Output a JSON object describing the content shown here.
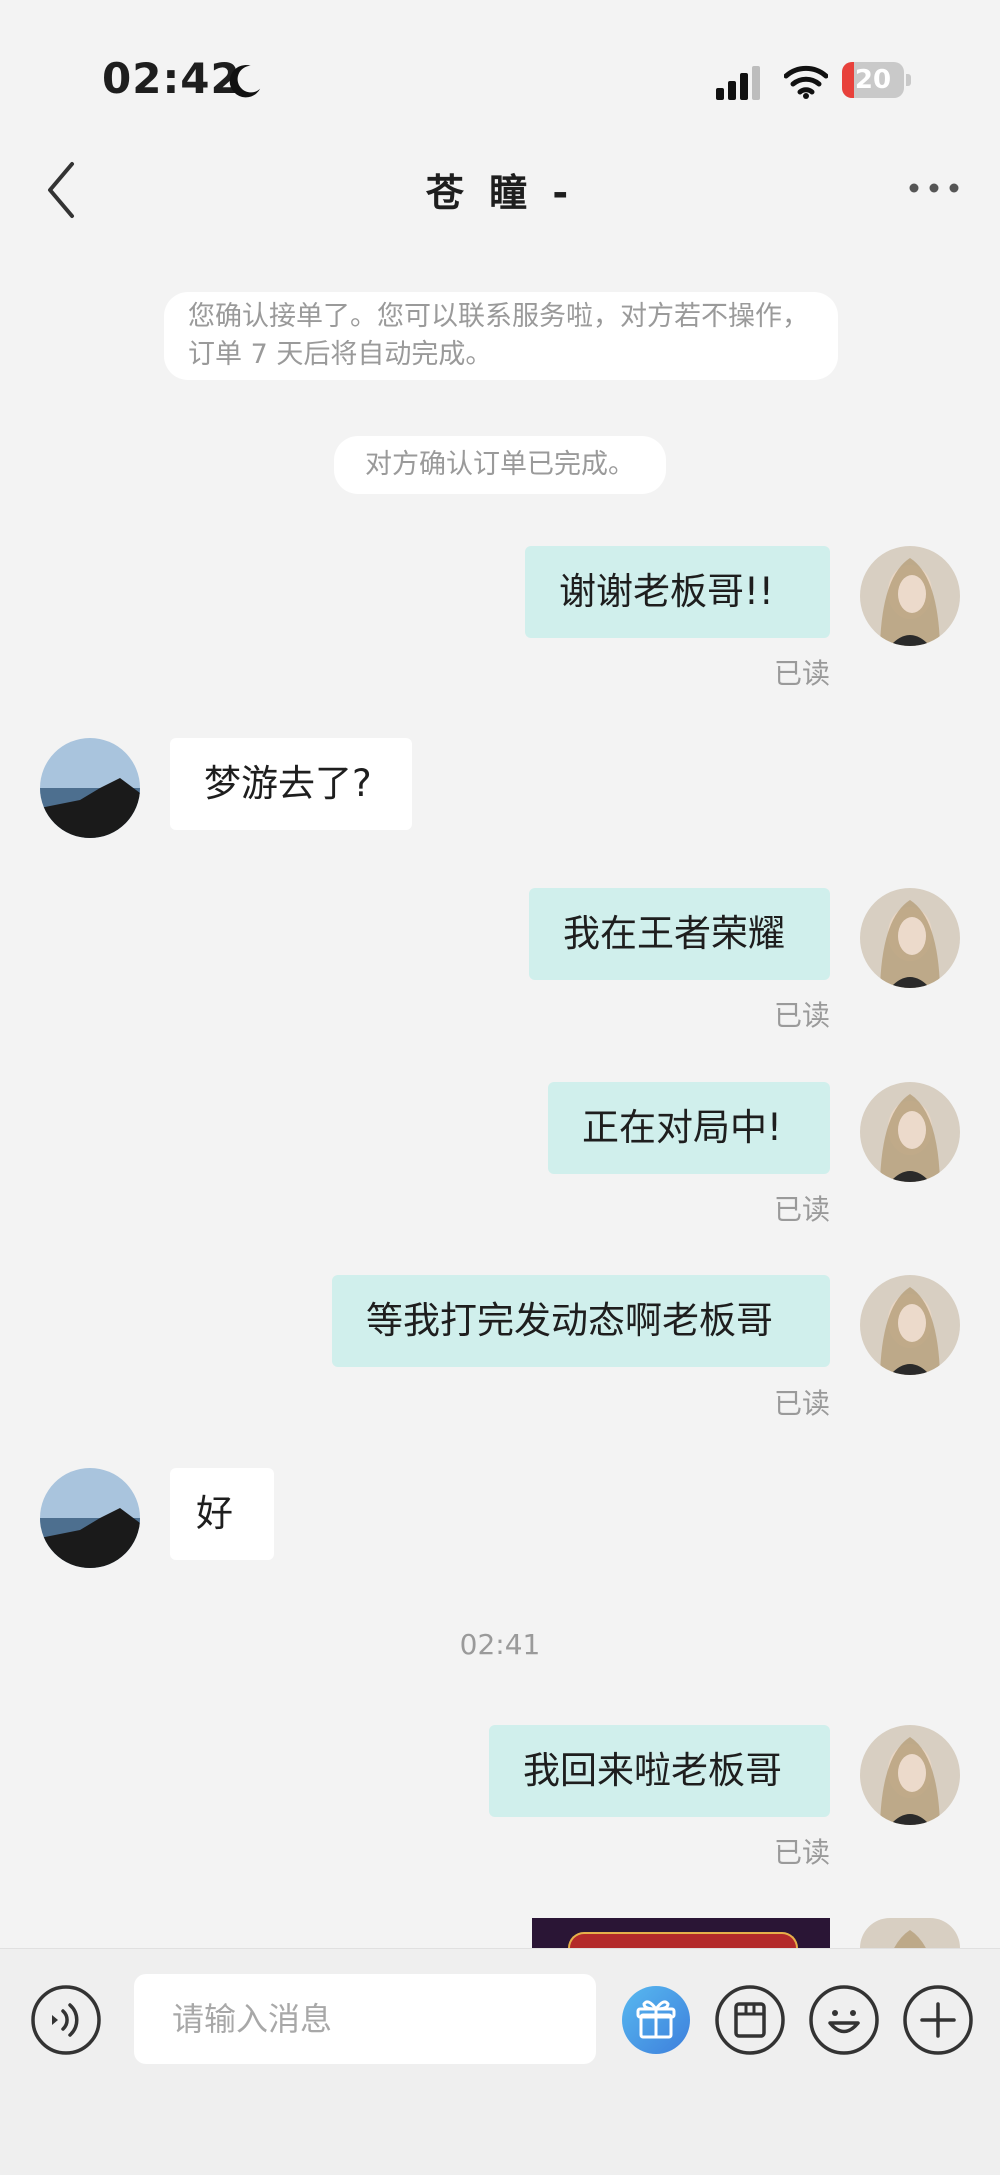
{
  "status_bar": {
    "time": "02:42",
    "battery_level": "20",
    "battery_fraction": 0.2,
    "battery_color": "#e8413b"
  },
  "header": {
    "title": "苍 瞳 -"
  },
  "system_notices": [
    "您确认接单了。您可以联系服务啦，对方若不操作，订单 7 天后将自动完成。",
    "对方确认订单已完成。"
  ],
  "messages": [
    {
      "sender": "me",
      "text": "谢谢老板哥!!",
      "status": "已读"
    },
    {
      "sender": "them",
      "text": "梦游去了?"
    },
    {
      "sender": "me",
      "text": "我在王者荣耀",
      "status": "已读"
    },
    {
      "sender": "me",
      "text": "正在对局中!",
      "status": "已读"
    },
    {
      "sender": "me",
      "text": "等我打完发动态啊老板哥",
      "status": "已读"
    },
    {
      "sender": "them",
      "text": "好"
    },
    {
      "sender": "me",
      "text": "我回来啦老板哥",
      "status": "已读"
    }
  ],
  "timestamp": "02:41",
  "input": {
    "placeholder": "请输入消息",
    "value": ""
  },
  "toolbar_icons": [
    "voice-icon",
    "gift-icon",
    "order-icon",
    "emoji-icon",
    "plus-icon"
  ],
  "colors": {
    "bubble_me": "#d0efec",
    "bubble_them": "#ffffff",
    "gift_accent": "#4fa3e8",
    "background": "#f3f3f3"
  }
}
